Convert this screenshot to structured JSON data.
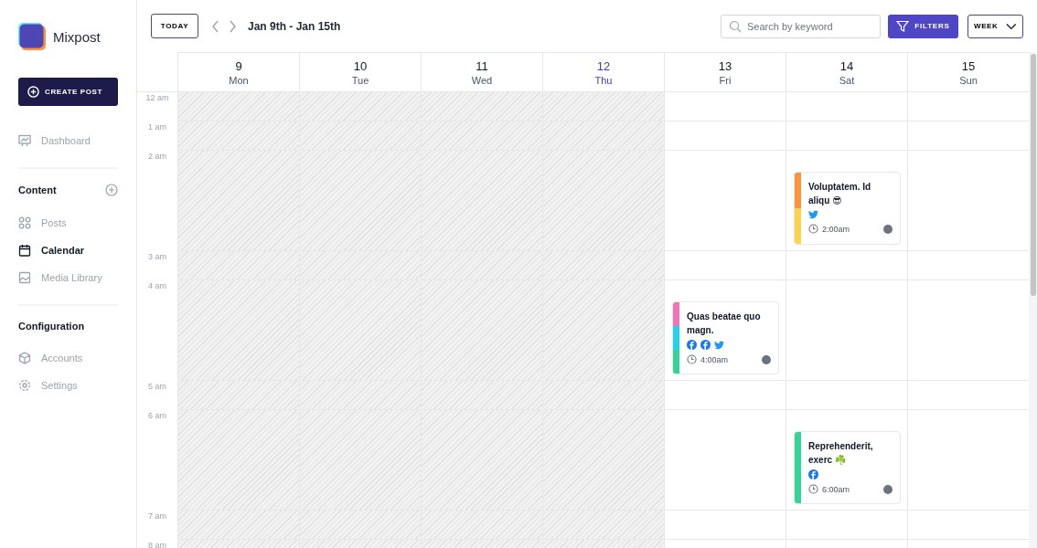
{
  "brand": {
    "name": "Mixpost"
  },
  "create_button": {
    "label": "CREATE POST"
  },
  "sidebar": {
    "sections": [
      {
        "items": [
          {
            "label": "Dashboard",
            "selected": false
          }
        ]
      },
      {
        "title": "Content",
        "items": [
          {
            "label": "Posts",
            "selected": false
          },
          {
            "label": "Calendar",
            "selected": true
          },
          {
            "label": "Media Library",
            "selected": false
          }
        ]
      },
      {
        "title": "Configuration",
        "items": [
          {
            "label": "Accounts",
            "selected": false
          },
          {
            "label": "Settings",
            "selected": false
          }
        ]
      }
    ]
  },
  "toolbar": {
    "today": "TODAY",
    "range": "Jan 9th - Jan 15th",
    "search": {
      "placeholder": "Search by keyword"
    },
    "filters": "FILTERS",
    "view": "WEEK"
  },
  "days": [
    {
      "number": "9",
      "name": "Mon",
      "selected": false
    },
    {
      "number": "10",
      "name": "Tue",
      "selected": false
    },
    {
      "number": "11",
      "name": "Wed",
      "selected": false
    },
    {
      "number": "12",
      "name": "Thu",
      "selected": true
    },
    {
      "number": "13",
      "name": "Fri",
      "selected": false
    },
    {
      "number": "14",
      "name": "Sat",
      "selected": false
    },
    {
      "number": "15",
      "name": "Sun",
      "selected": false
    }
  ],
  "hours": [
    {
      "label": "12 am",
      "cells": [
        {
          "past": true
        },
        {
          "past": true
        },
        {
          "past": true
        },
        {
          "past": true
        },
        {
          "past": false
        },
        {
          "past": false
        },
        {
          "past": false
        }
      ]
    },
    {
      "label": "1 am",
      "cells": [
        {
          "past": true
        },
        {
          "past": true
        },
        {
          "past": true
        },
        {
          "past": true
        },
        {
          "past": false
        },
        {
          "past": false
        },
        {
          "past": false
        }
      ]
    },
    {
      "label": "2 am",
      "cells": [
        {
          "past": true
        },
        {
          "past": true
        },
        {
          "past": true
        },
        {
          "past": true
        },
        {
          "past": false
        },
        {
          "past": false,
          "post": {
            "title": "Voluptatem. Id aliqu 😎",
            "stripes": [
              {
                "color": "#fb923c"
              },
              {
                "color": "#fcd34d"
              }
            ],
            "networks": [
              {
                "kind": "twitter"
              }
            ],
            "time": "2:00am"
          }
        },
        {
          "past": false
        }
      ]
    },
    {
      "label": "3 am",
      "cells": [
        {
          "past": true
        },
        {
          "past": true
        },
        {
          "past": true
        },
        {
          "past": true
        },
        {
          "past": false
        },
        {
          "past": false
        },
        {
          "past": false
        }
      ]
    },
    {
      "label": "4 am",
      "cells": [
        {
          "past": true
        },
        {
          "past": true
        },
        {
          "past": true
        },
        {
          "past": true
        },
        {
          "past": false,
          "post": {
            "title": "Quas beatae quo magn.",
            "stripes": [
              {
                "color": "#f472b6"
              },
              {
                "color": "#22d3ee"
              },
              {
                "color": "#34d399"
              }
            ],
            "networks": [
              {
                "kind": "facebook"
              },
              {
                "kind": "facebook"
              },
              {
                "kind": "twitter"
              }
            ],
            "time": "4:00am"
          }
        },
        {
          "past": false
        },
        {
          "past": false
        }
      ]
    },
    {
      "label": "5 am",
      "cells": [
        {
          "past": true
        },
        {
          "past": true
        },
        {
          "past": true
        },
        {
          "past": true
        },
        {
          "past": false
        },
        {
          "past": false
        },
        {
          "past": false
        }
      ]
    },
    {
      "label": "6 am",
      "cells": [
        {
          "past": true
        },
        {
          "past": true
        },
        {
          "past": true
        },
        {
          "past": true
        },
        {
          "past": false
        },
        {
          "past": false,
          "post": {
            "title": "Reprehenderit, exerc ☘️",
            "stripes": [
              {
                "color": "#34d399"
              }
            ],
            "networks": [
              {
                "kind": "facebook"
              }
            ],
            "time": "6:00am"
          }
        },
        {
          "past": false
        }
      ]
    },
    {
      "label": "7 am",
      "cells": [
        {
          "past": true
        },
        {
          "past": true
        },
        {
          "past": true
        },
        {
          "past": true
        },
        {
          "past": false
        },
        {
          "past": false
        },
        {
          "past": false
        }
      ]
    },
    {
      "label": "8 am",
      "cells": [
        {
          "past": true
        },
        {
          "past": true
        },
        {
          "past": true
        },
        {
          "past": true
        },
        {
          "past": false
        },
        {
          "past": false
        },
        {
          "past": false
        }
      ]
    }
  ]
}
